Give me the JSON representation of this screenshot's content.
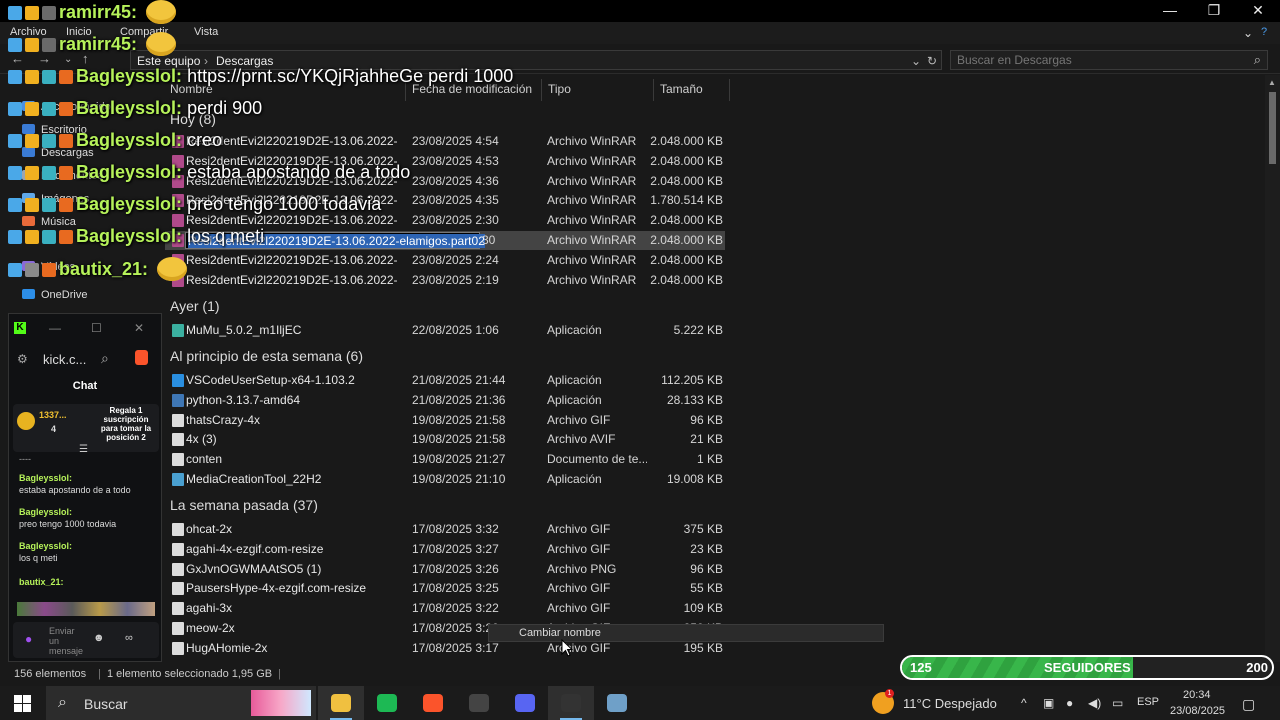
{
  "window": {
    "minimize": "—",
    "maximize": "❐",
    "close": "✕"
  },
  "ribbon": {
    "tabs": [
      "Archivo",
      "Inicio",
      "Compartir",
      "Vista"
    ]
  },
  "address": {
    "crumbs": [
      "Este equipo",
      "Descargas"
    ],
    "search_placeholder": "Buscar en Descargas"
  },
  "nav": {
    "items": [
      {
        "label": "Acceso rápido",
        "color": "#4a90e2"
      },
      {
        "label": "Escritorio",
        "color": "#3a7bd5"
      },
      {
        "label": "Descargas",
        "color": "#3a7bd5"
      },
      {
        "label": "Documentos",
        "color": "#9aa5b1"
      },
      {
        "label": "Imágenes",
        "color": "#5fa8e8"
      },
      {
        "label": "Música",
        "color": "#e86a3a"
      },
      {
        "label": "Vídeos",
        "color": "#8a6ad8"
      },
      {
        "label": "OneDrive",
        "color": "#2c8ee8"
      }
    ]
  },
  "columns": {
    "name": "Nombre",
    "date": "Fecha de modificación",
    "type": "Tipo",
    "size": "Tamaño"
  },
  "groups": [
    {
      "title": "Hoy (8)",
      "rows": [
        {
          "name": "Resi2dentEvi2l220219D2E-13.06.2022-ela...",
          "date": "23/08/2025 4:54",
          "type": "Archivo WinRAR",
          "size": "2.048.000 KB",
          "color": "#b04a8a"
        },
        {
          "name": "Resi2dentEvi2l220219D2E-13.06.2022-ela...",
          "date": "23/08/2025 4:53",
          "type": "Archivo WinRAR",
          "size": "2.048.000 KB",
          "color": "#b04a8a"
        },
        {
          "name": "Resi2dentEvi2l220219D2E-13.06.2022-ela...",
          "date": "23/08/2025 4:36",
          "type": "Archivo WinRAR",
          "size": "2.048.000 KB",
          "color": "#b04a8a"
        },
        {
          "name": "Resi2dentEvi2l220219D2E-13.06.2022-ela...",
          "date": "23/08/2025 4:35",
          "type": "Archivo WinRAR",
          "size": "1.780.514 KB",
          "color": "#b04a8a"
        },
        {
          "name": "Resi2dentEvi2l220219D2E-13.06.2022-ela...",
          "date": "23/08/2025 2:30",
          "type": "Archivo WinRAR",
          "size": "2.048.000 KB",
          "color": "#b04a8a"
        },
        {
          "name": "Resi2dentEvi2l220219D2E-13.06.2022-elamigos.part02",
          "date": "30",
          "type": "Archivo WinRAR",
          "size": "2.048.000 KB",
          "color": "#b04a8a",
          "selected": true,
          "rename": "Resi2dentEvi2l220219D2E-13.06.2022-elamigos.part02"
        },
        {
          "name": "Resi2dentEvi2l220219D2E-13.06.2022-ela...",
          "date": "23/08/2025 2:24",
          "type": "Archivo WinRAR",
          "size": "2.048.000 KB",
          "color": "#b04a8a"
        },
        {
          "name": "Resi2dentEvi2l220219D2E-13.06.2022-ela...",
          "date": "23/08/2025 2:19",
          "type": "Archivo WinRAR",
          "size": "2.048.000 KB",
          "color": "#b04a8a"
        }
      ]
    },
    {
      "title": "Ayer (1)",
      "rows": [
        {
          "name": "MuMu_5.0.2_m1IljEC",
          "date": "22/08/2025 1:06",
          "type": "Aplicación",
          "size": "5.222 KB",
          "color": "#3bb0a0"
        }
      ]
    },
    {
      "title": "Al principio de esta semana (6)",
      "rows": [
        {
          "name": "VSCodeUserSetup-x64-1.103.2",
          "date": "21/08/2025 21:44",
          "type": "Aplicación",
          "size": "112.205 KB",
          "color": "#2a8fe0"
        },
        {
          "name": "python-3.13.7-amd64",
          "date": "21/08/2025 21:36",
          "type": "Aplicación",
          "size": "28.133 KB",
          "color": "#3f77b5"
        },
        {
          "name": "thatsCrazy-4x",
          "date": "19/08/2025 21:58",
          "type": "Archivo GIF",
          "size": "96 KB",
          "color": "#dcdcdc"
        },
        {
          "name": "4x (3)",
          "date": "19/08/2025 21:58",
          "type": "Archivo AVIF",
          "size": "21 KB",
          "color": "#dcdcdc"
        },
        {
          "name": "conten",
          "date": "19/08/2025 21:27",
          "type": "Documento de te...",
          "size": "1 KB",
          "color": "#dcdcdc"
        },
        {
          "name": "MediaCreationTool_22H2",
          "date": "19/08/2025 21:10",
          "type": "Aplicación",
          "size": "19.008 KB",
          "color": "#4aa0d0"
        }
      ]
    },
    {
      "title": "La semana pasada (37)",
      "rows": [
        {
          "name": "ohcat-2x",
          "date": "17/08/2025 3:32",
          "type": "Archivo GIF",
          "size": "375 KB",
          "color": "#dcdcdc"
        },
        {
          "name": "agahi-4x-ezgif.com-resize",
          "date": "17/08/2025 3:27",
          "type": "Archivo GIF",
          "size": "23 KB",
          "color": "#dcdcdc"
        },
        {
          "name": "GxJvnOGWMAAtSO5 (1)",
          "date": "17/08/2025 3:26",
          "type": "Archivo PNG",
          "size": "96 KB",
          "color": "#dcdcdc"
        },
        {
          "name": "PausersHype-4x-ezgif.com-resize",
          "date": "17/08/2025 3:25",
          "type": "Archivo GIF",
          "size": "55 KB",
          "color": "#dcdcdc"
        },
        {
          "name": "agahi-3x",
          "date": "17/08/2025 3:22",
          "type": "Archivo GIF",
          "size": "109 KB",
          "color": "#dcdcdc"
        },
        {
          "name": "meow-2x",
          "date": "17/08/2025 3:20",
          "type": "Archivo GIF",
          "size": "250 KB",
          "color": "#dcdcdc"
        },
        {
          "name": "HugAHomie-2x",
          "date": "17/08/2025 3:17",
          "type": "Archivo GIF",
          "size": "195 KB",
          "color": "#dcdcdc"
        }
      ]
    }
  ],
  "tooltip": "Cambiar nombre",
  "status": {
    "count": "156 elementos",
    "selected": "1 elemento seleccionado  1,95 GB"
  },
  "overlay": [
    {
      "user": "ramirr45:",
      "msg": "",
      "emoji": true
    },
    {
      "user": "ramirr45:",
      "msg": "",
      "emoji": true
    },
    {
      "user": "Bagleysslol:",
      "msg": "https://prnt.sc/YKQjRjahheGe perdi 1000"
    },
    {
      "user": "Bagleysslol:",
      "msg": "perdi 900"
    },
    {
      "user": "Bagleysslol:",
      "msg": "creo"
    },
    {
      "user": "Bagleysslol:",
      "msg": "estaba apostando de a todo"
    },
    {
      "user": "Bagleysslol:",
      "msg": "preo tengo 1000 todavia"
    },
    {
      "user": "Bagleysslol:",
      "msg": "los q meti"
    },
    {
      "user": "bautix_21:",
      "msg": "",
      "emoji": true
    }
  ],
  "kick": {
    "url": "kick.c...",
    "header": "Chat",
    "pinned_count": "1337...",
    "pinned_sub": "4",
    "pinned_text": "Regala 1 suscripción para tomar la posición 2",
    "divider": "----",
    "messages": [
      {
        "user": "Bagleysslol:",
        "text": "estaba apostando de a todo"
      },
      {
        "user": "Bagleysslol:",
        "text": "preo tengo 1000 todavia"
      },
      {
        "user": "Bagleysslol:",
        "text": "los q meti"
      },
      {
        "user": "bautix_21:",
        "text": ""
      }
    ],
    "input_placeholder": "Enviar un mensaje"
  },
  "followers": {
    "current": "125",
    "label": "SEGUIDORES",
    "goal": "200",
    "progress": 0.625
  },
  "taskbar": {
    "search": "Buscar",
    "weather": "11°C  Despejado",
    "lang": "ESP",
    "time": "20:34",
    "date": "23/08/2025",
    "apps": [
      {
        "name": "file-explorer",
        "color": "#f0c040"
      },
      {
        "name": "spotify",
        "color": "#1db954"
      },
      {
        "name": "brave",
        "color": "#fb542b"
      },
      {
        "name": "obs",
        "color": "#444"
      },
      {
        "name": "discord",
        "color": "#5865f2"
      },
      {
        "name": "chrome-app",
        "color": "#333"
      },
      {
        "name": "editor",
        "color": "#6fa0c8"
      }
    ]
  }
}
